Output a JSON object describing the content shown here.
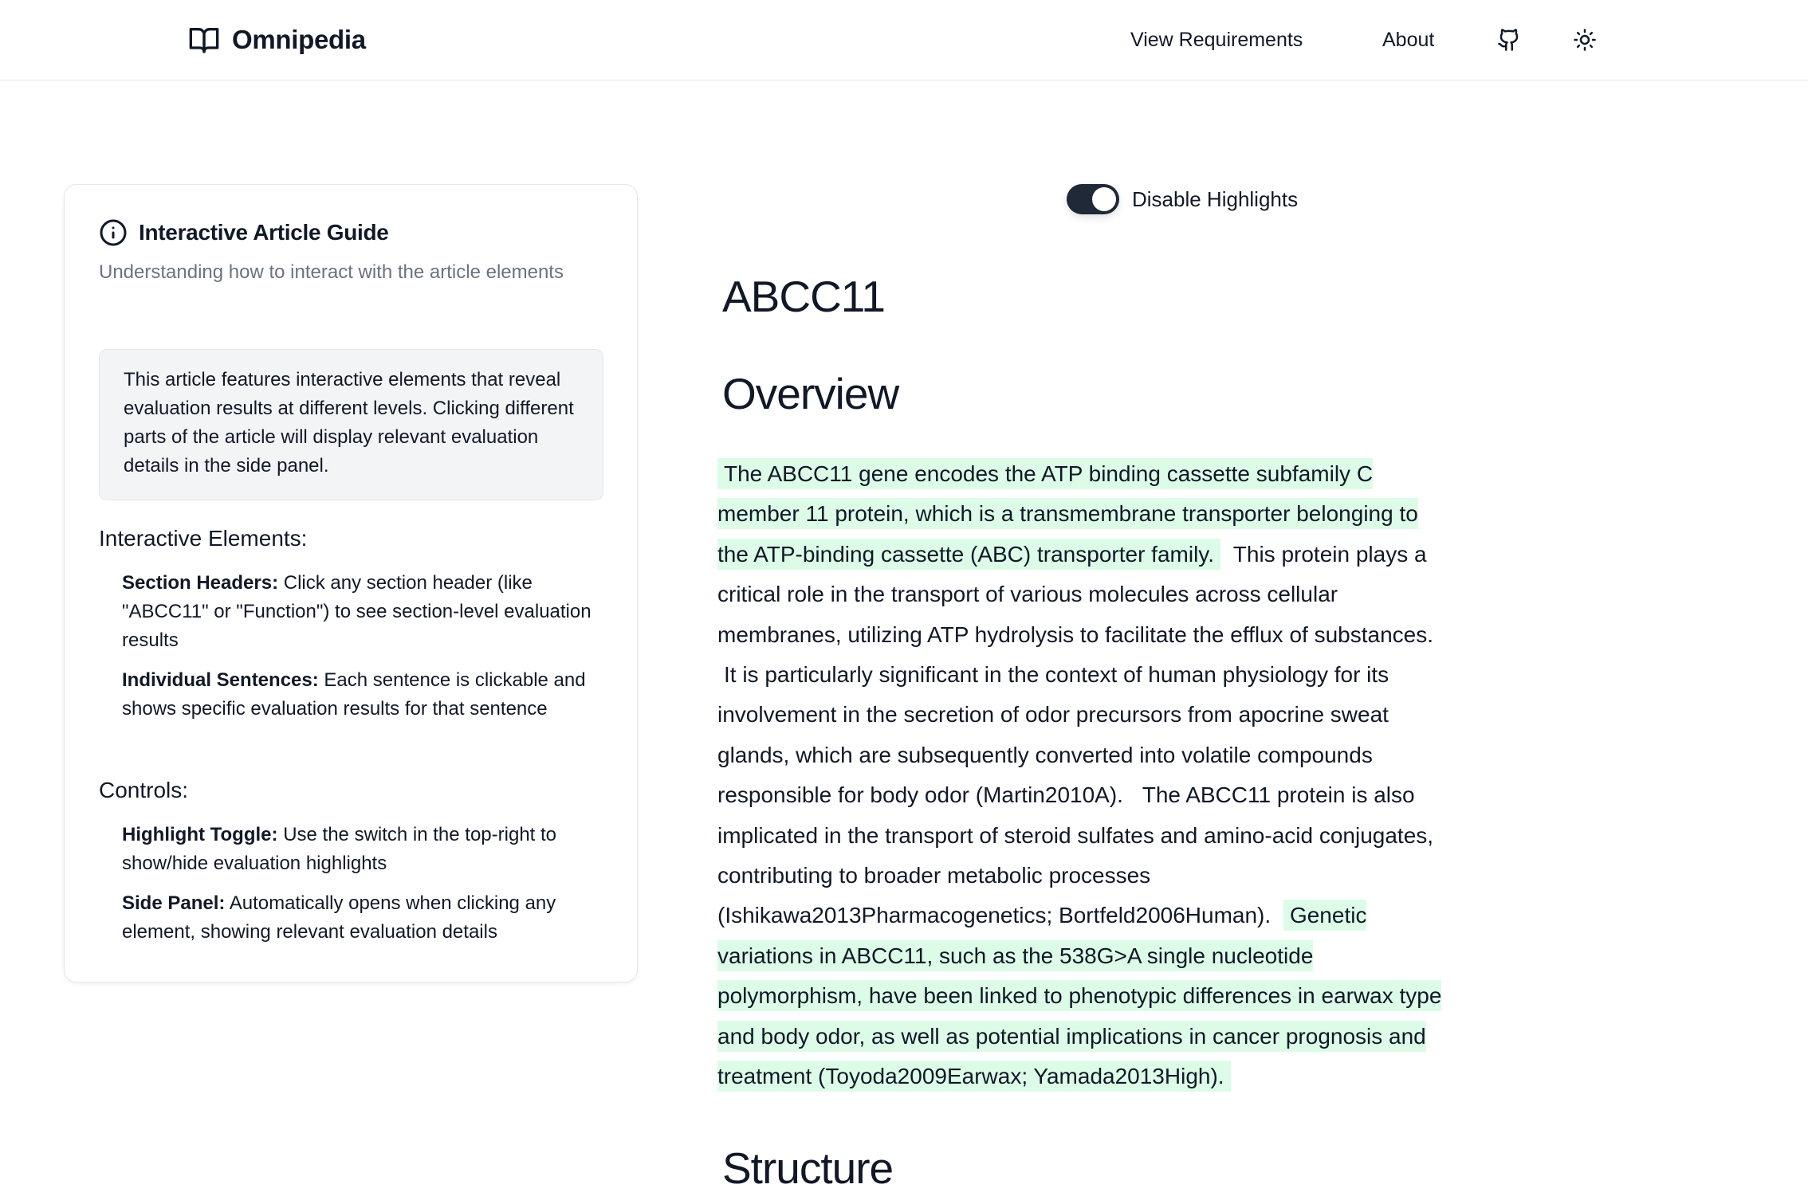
{
  "header": {
    "brand": "Omnipedia",
    "nav": {
      "requirements": "View Requirements",
      "about": "About"
    },
    "icons": {
      "brand": "open-book-icon",
      "github": "github-icon",
      "theme": "sun-icon"
    }
  },
  "guide": {
    "title": "Interactive Article Guide",
    "subtitle": "Understanding how to interact with the article elements",
    "note": "This article features interactive elements that reveal evaluation results at different levels. Clicking different parts of the article will display relevant evaluation details in the side panel.",
    "elements_heading": "Interactive Elements:",
    "elements": [
      {
        "term": "Section Headers:",
        "desc": "Click any section header (like \"ABCC11\" or \"Function\") to see section-level evaluation results"
      },
      {
        "term": "Individual Sentences:",
        "desc": "Each sentence is clickable and shows specific evaluation results for that sentence"
      }
    ],
    "controls_heading": "Controls:",
    "controls": [
      {
        "term": "Highlight Toggle:",
        "desc": "Use the switch in the top-right to show/hide evaluation highlights"
      },
      {
        "term": "Side Panel:",
        "desc": "Automatically opens when clicking any element, showing relevant evaluation details"
      }
    ]
  },
  "toggle": {
    "label": "Disable Highlights",
    "on": true
  },
  "article": {
    "title": "ABCC11",
    "sections": [
      {
        "heading": "Overview",
        "sentences": [
          {
            "text": "The ABCC11 gene encodes the ATP binding cassette subfamily C member 11 protein, which is a transmembrane transporter belonging to the ATP-binding cassette (ABC) transporter family.",
            "highlight": true
          },
          {
            "text": "This protein plays a critical role in the transport of various molecules across cellular membranes, utilizing ATP hydrolysis to facilitate the efflux of substances.",
            "highlight": false
          },
          {
            "text": "It is particularly significant in the context of human physiology for its involvement in the secretion of odor precursors from apocrine sweat glands, which are subsequently converted into volatile compounds responsible for body odor (Martin2010A).",
            "highlight": false
          },
          {
            "text": "The ABCC11 protein is also implicated in the transport of steroid sulfates and amino-acid conjugates, contributing to broader metabolic processes (Ishikawa2013Pharmacogenetics; Bortfeld2006Human).",
            "highlight": false
          },
          {
            "text": "Genetic variations in ABCC11, such as the 538G>A single nucleotide polymorphism, have been linked to phenotypic differences in earwax type and body odor, as well as potential implications in cancer prognosis and treatment (Toyoda2009Earwax; Yamada2013High).",
            "highlight": true
          }
        ]
      },
      {
        "heading": "Structure",
        "sentences": []
      }
    ]
  },
  "colors": {
    "highlight": "#dcfce7",
    "toggle_on": "#1f2937",
    "text": "#111827",
    "muted": "#6b7280"
  }
}
